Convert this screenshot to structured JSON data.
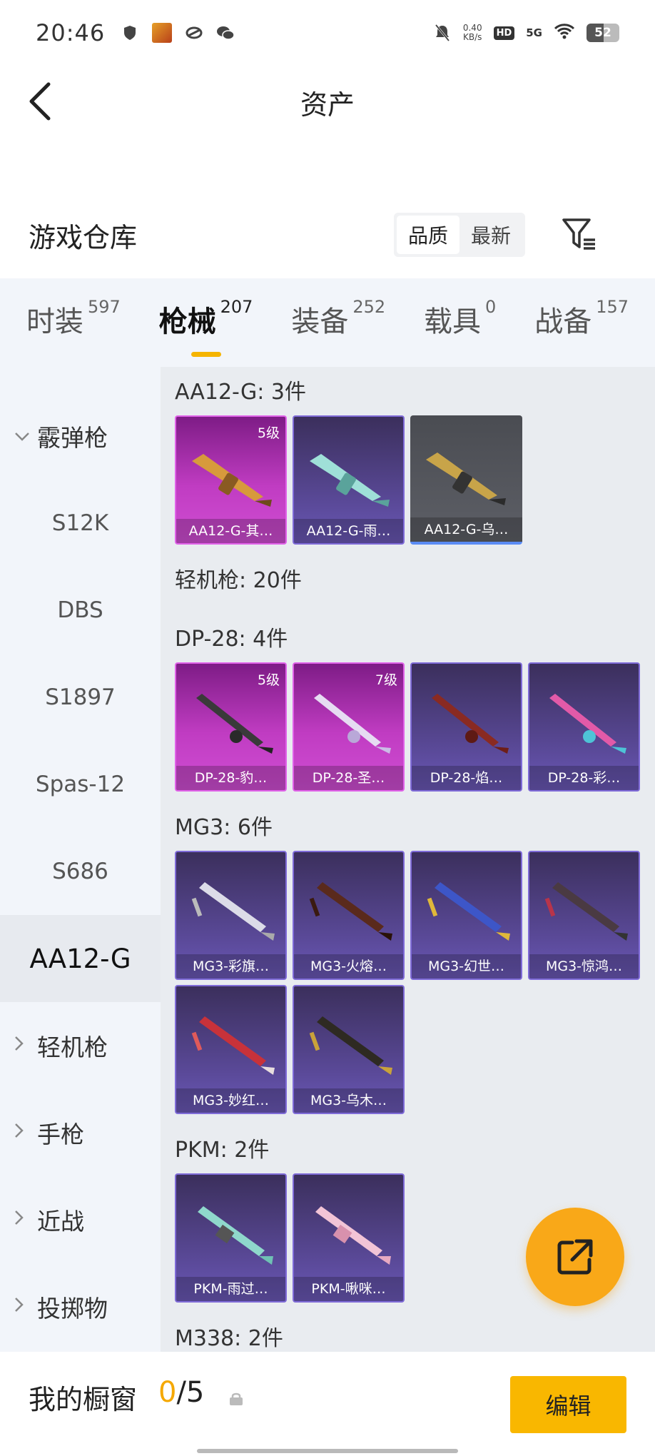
{
  "status_bar": {
    "time": "20:46",
    "speed_value": "0.40",
    "speed_unit": "KB/s",
    "hd": "HD",
    "network": "5G",
    "battery": "52",
    "icons": [
      "shield-icon",
      "app-icon",
      "link-icon",
      "wechat-icon",
      "mute-bell-icon",
      "wifi-icon"
    ]
  },
  "header": {
    "title": "资产"
  },
  "warehouse": {
    "title": "游戏仓库",
    "sort_quality": "品质",
    "sort_newest": "最新"
  },
  "tabs": [
    {
      "label": "时装",
      "count": "597"
    },
    {
      "label": "枪械",
      "count": "207",
      "active": true
    },
    {
      "label": "装备",
      "count": "252"
    },
    {
      "label": "载具",
      "count": "0"
    },
    {
      "label": "战备",
      "count": "157"
    }
  ],
  "sidebar": {
    "shotgun": "霰弹枪",
    "items": [
      "S12K",
      "DBS",
      "S1897",
      "Spas-12",
      "S686",
      "AA12-G"
    ],
    "lmg": "轻机枪",
    "pistol": "手枪",
    "melee": "近战",
    "throwable": "投掷物"
  },
  "content": {
    "aa12_title": "AA12-G: 3件",
    "aa12_cards": [
      {
        "name": "AA12-G-其…",
        "level": "5级"
      },
      {
        "name": "AA12-G-雨…"
      },
      {
        "name": "AA12-G-乌…"
      }
    ],
    "lmg_title": "轻机枪: 20件",
    "dp28_title": "DP-28: 4件",
    "dp28_cards": [
      {
        "name": "DP-28-豹…",
        "level": "5级"
      },
      {
        "name": "DP-28-圣…",
        "level": "7级"
      },
      {
        "name": "DP-28-焰…"
      },
      {
        "name": "DP-28-彩…"
      }
    ],
    "mg3_title": "MG3: 6件",
    "mg3_cards": [
      {
        "name": "MG3-彩旗…"
      },
      {
        "name": "MG3-火熔…"
      },
      {
        "name": "MG3-幻世…"
      },
      {
        "name": "MG3-惊鸿…"
      },
      {
        "name": "MG3-妙红…"
      },
      {
        "name": "MG3-乌木…"
      }
    ],
    "pkm_title": "PKM: 2件",
    "pkm_cards": [
      {
        "name": "PKM-雨过…"
      },
      {
        "name": "PKM-啾咪…"
      }
    ],
    "m338_title": "M338: 2件"
  },
  "bottom": {
    "label": "我的橱窗",
    "count_current": "0",
    "count_total": "/5",
    "edit": "编辑"
  },
  "colors": {
    "accent": "#f9b700",
    "purple_card": "#5b4a9a",
    "pink_card": "#c03cc2",
    "tab_bg": "#f2f5fa"
  }
}
